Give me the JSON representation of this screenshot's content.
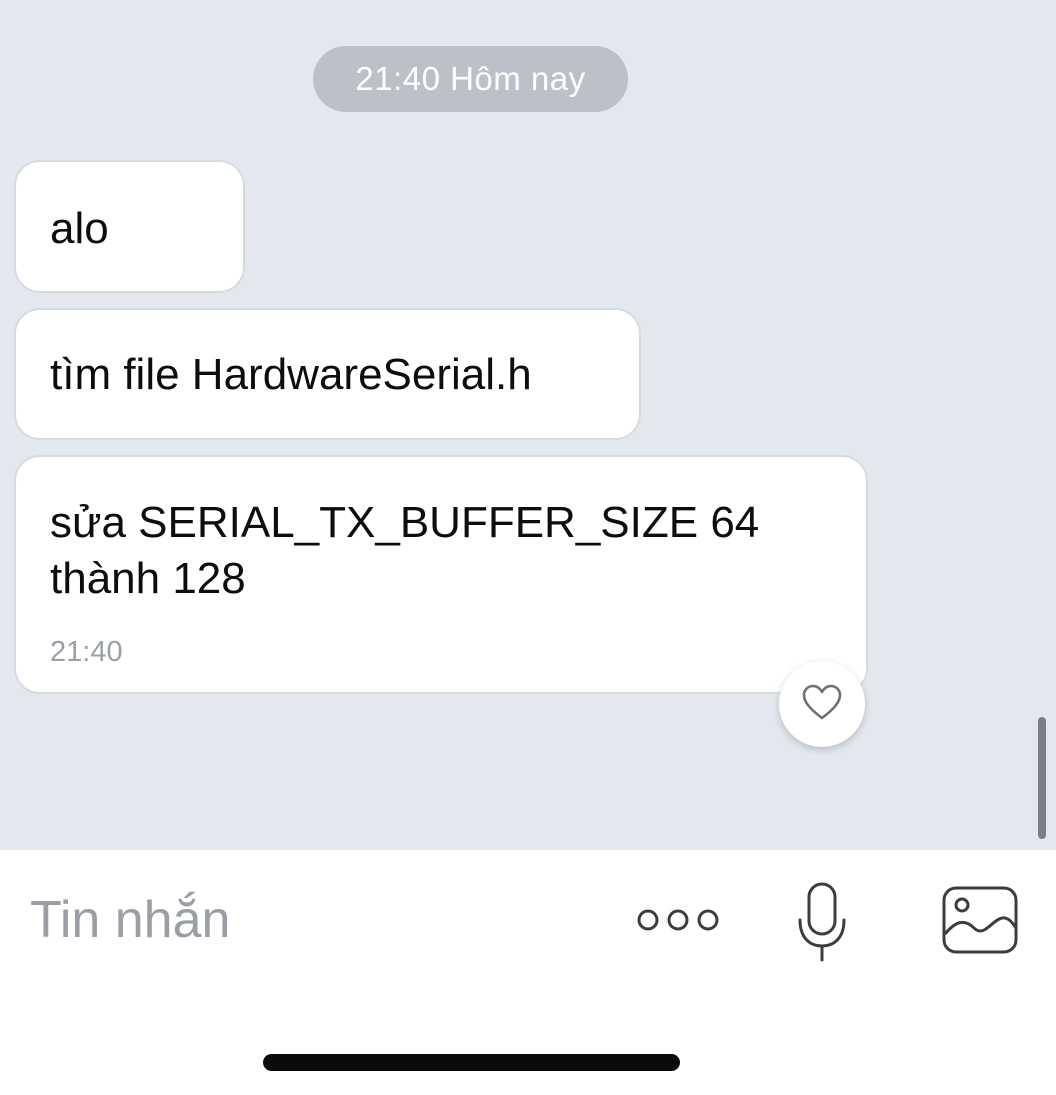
{
  "chat": {
    "date_label": "21:40 Hôm nay",
    "messages": [
      {
        "text": "alo"
      },
      {
        "text": "tìm file HardwareSerial.h"
      },
      {
        "text_line1": "sửa SERIAL_TX_BUFFER_SIZE 64",
        "text_line2": "thành 128",
        "time": "21:40"
      }
    ],
    "reaction_icon": "heart-outline-icon"
  },
  "composer": {
    "placeholder": "Tin nhắn",
    "icons": [
      "more-icon",
      "mic-icon",
      "image-icon"
    ]
  },
  "colors": {
    "chat_background": "#e3e8ef",
    "bubble_background": "#ffffff",
    "date_pill": "#bcc1c9"
  }
}
